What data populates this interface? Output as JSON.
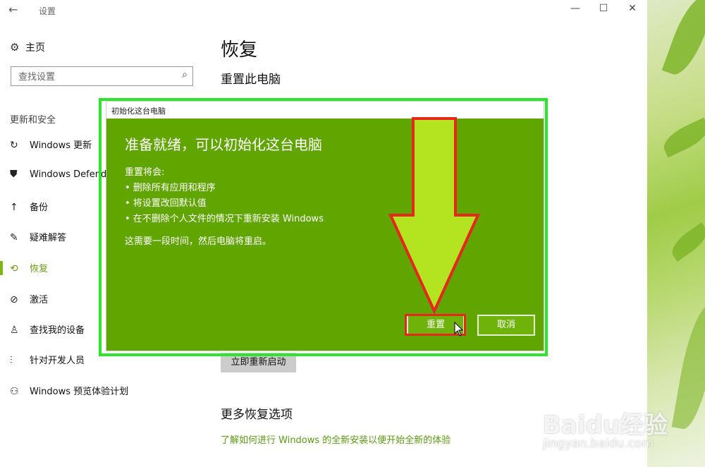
{
  "window": {
    "title": "设置",
    "back_icon": "←",
    "minimize_icon": "—",
    "maximize_icon": "☐",
    "close_icon": "✕"
  },
  "sidebar": {
    "home_icon": "⚙",
    "home_label": "主页",
    "search_placeholder": "查找设置",
    "search_icon": "⌕",
    "section_label": "更新和安全",
    "items": [
      {
        "icon": "↻",
        "label": "Windows 更新"
      },
      {
        "icon": "⛊",
        "label": "Windows Defender"
      },
      {
        "icon": "↑",
        "label": "备份"
      },
      {
        "icon": "✎",
        "label": "疑难解答"
      },
      {
        "icon": "⟲",
        "label": "恢复"
      },
      {
        "icon": "⊘",
        "label": "激活"
      },
      {
        "icon": "♙",
        "label": "查找我的设备"
      },
      {
        "icon": "⫶",
        "label": "针对开发人员"
      },
      {
        "icon": "⚇",
        "label": "Windows 预览体验计划"
      }
    ],
    "active_index": 4
  },
  "main": {
    "page_title": "恢复",
    "section_reset": "重置此电脑",
    "restart_now_button": "立即重新启动",
    "more_options_title": "更多恢复选项",
    "more_options_link": "了解如何进行 Windows 的全新安装以便开始全新的体验"
  },
  "dialog": {
    "title": "初始化这台电脑",
    "heading": "准备就绪，可以初始化这台电脑",
    "intro": "重置将会:",
    "bullets": [
      "• 删除所有应用和程序",
      "• 将设置改回默认值",
      "• 在不删除个人文件的情况下重新安装 Windows"
    ],
    "note": "这需要一段时间，然后电脑将重启。",
    "reset_button": "重置",
    "cancel_button": "取消"
  },
  "watermark": {
    "brand": "Baidu经验",
    "url": "jingyan.baidu.com"
  },
  "colors": {
    "dialog_bg": "#61a500",
    "accent": "#7cb518",
    "highlight_green": "#2ee52e",
    "highlight_red": "#e5271e",
    "arrow_fill": "#b4e41f"
  }
}
